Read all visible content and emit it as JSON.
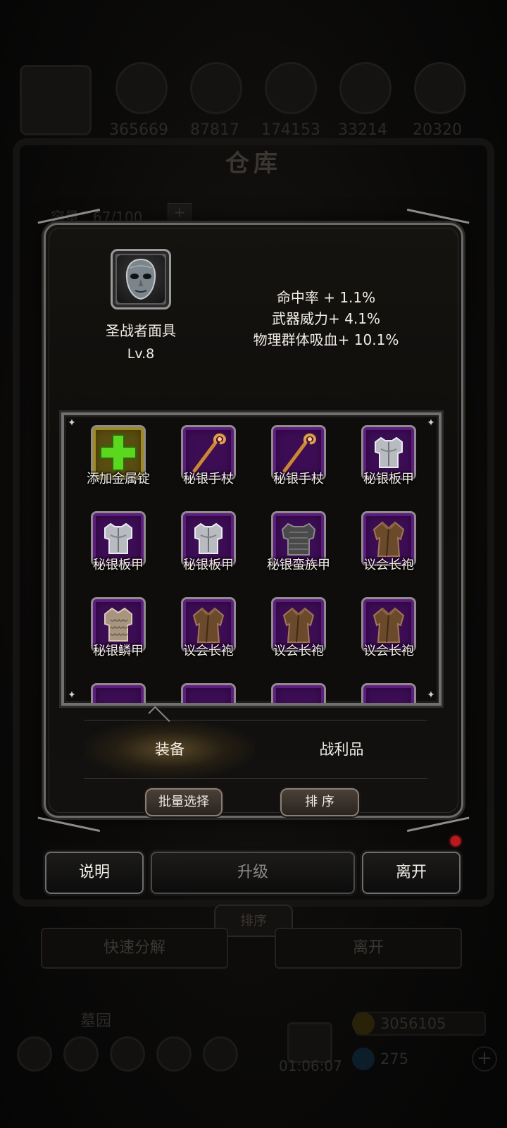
{
  "background": {
    "resources": [
      "365669",
      "87817",
      "174153",
      "33214",
      "20320"
    ],
    "title": "仓库",
    "capacity_label": "容量：67/100",
    "capacity_plus": "+",
    "sort_label": "排序",
    "quick_disassemble_label": "快速分解",
    "leave_label": "离开",
    "tomb_label": "墓园",
    "timer": "01:06:07",
    "gold": "3056105",
    "gems": "275",
    "plus": "+"
  },
  "item": {
    "name": "圣战者面具",
    "level": "Lv.8",
    "icon": "mask-icon",
    "stats": [
      "命中率 + 1.1%",
      "武器威力+ 4.1%",
      "物理群体吸血+ 10.1%"
    ]
  },
  "inventory": {
    "cells": [
      {
        "label": "添加金属锭",
        "icon": "add-plus-icon",
        "kind": "add"
      },
      {
        "label": "秘银手杖",
        "icon": "staff-icon",
        "kind": "item"
      },
      {
        "label": "秘银手杖",
        "icon": "staff-icon",
        "kind": "item"
      },
      {
        "label": "秘银板甲",
        "icon": "plate-armor-icon",
        "kind": "item"
      },
      {
        "label": "秘银板甲",
        "icon": "plate-armor-icon",
        "kind": "item"
      },
      {
        "label": "秘银板甲",
        "icon": "plate-armor-icon",
        "kind": "item"
      },
      {
        "label": "秘银蛮族甲",
        "icon": "barbarian-armor-icon",
        "kind": "item"
      },
      {
        "label": "议会长袍",
        "icon": "robe-icon",
        "kind": "item"
      },
      {
        "label": "秘银鳞甲",
        "icon": "scale-armor-icon",
        "kind": "item"
      },
      {
        "label": "议会长袍",
        "icon": "robe-icon",
        "kind": "item"
      },
      {
        "label": "议会长袍",
        "icon": "robe-icon",
        "kind": "item"
      },
      {
        "label": "议会长袍",
        "icon": "robe-icon",
        "kind": "item"
      }
    ]
  },
  "tabs": [
    {
      "label": "装备",
      "active": true
    },
    {
      "label": "战利品",
      "active": false
    }
  ],
  "actions": {
    "batch_select": "批量选择",
    "sort": "排 序",
    "info": "说明",
    "upgrade": "升级",
    "leave": "离开"
  },
  "colors": {
    "slot_purple": "#3c0d54",
    "add_green": "#5ad81e",
    "notification_red": "#c0181a"
  }
}
